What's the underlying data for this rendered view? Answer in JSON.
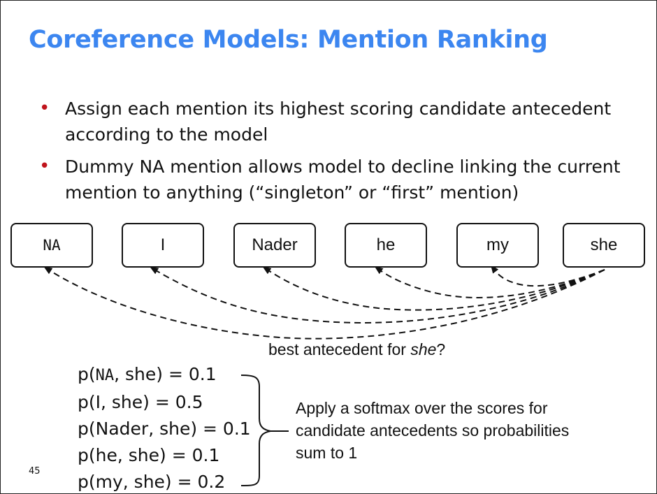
{
  "slide": {
    "title": "Coreference Models: Mention Ranking",
    "bullets": [
      "Assign each mention its highest scoring candidate antecedent according to the model",
      "Dummy NA mention allows model to decline linking the current mention to anything (“singleton” or “first” mention)"
    ],
    "mentions": [
      "NA",
      "I",
      "Nader",
      "he",
      "my",
      "she"
    ],
    "question_prefix": "best antecedent for ",
    "question_emph": "she",
    "question_suffix": "?",
    "probabilities": [
      {
        "label": "p(",
        "mention": "NA",
        "rest": ", she) = 0.1"
      },
      {
        "label": "p(",
        "mention": "I",
        "rest": ", she) = 0.5"
      },
      {
        "label": "p(",
        "mention": "Nader",
        "rest": ", she) = 0.1"
      },
      {
        "label": "p(",
        "mention": "he",
        "rest": ", she) = 0.1"
      },
      {
        "label": "p(",
        "mention": "my",
        "rest": ", she) = 0.2"
      }
    ],
    "softmax_note": "Apply a softmax over the scores for candidate antecedents so probabilities sum to 1",
    "page_number": "45",
    "colors": {
      "title": "#3c86f0",
      "bullet": "#c0141c",
      "text": "#111111"
    }
  }
}
